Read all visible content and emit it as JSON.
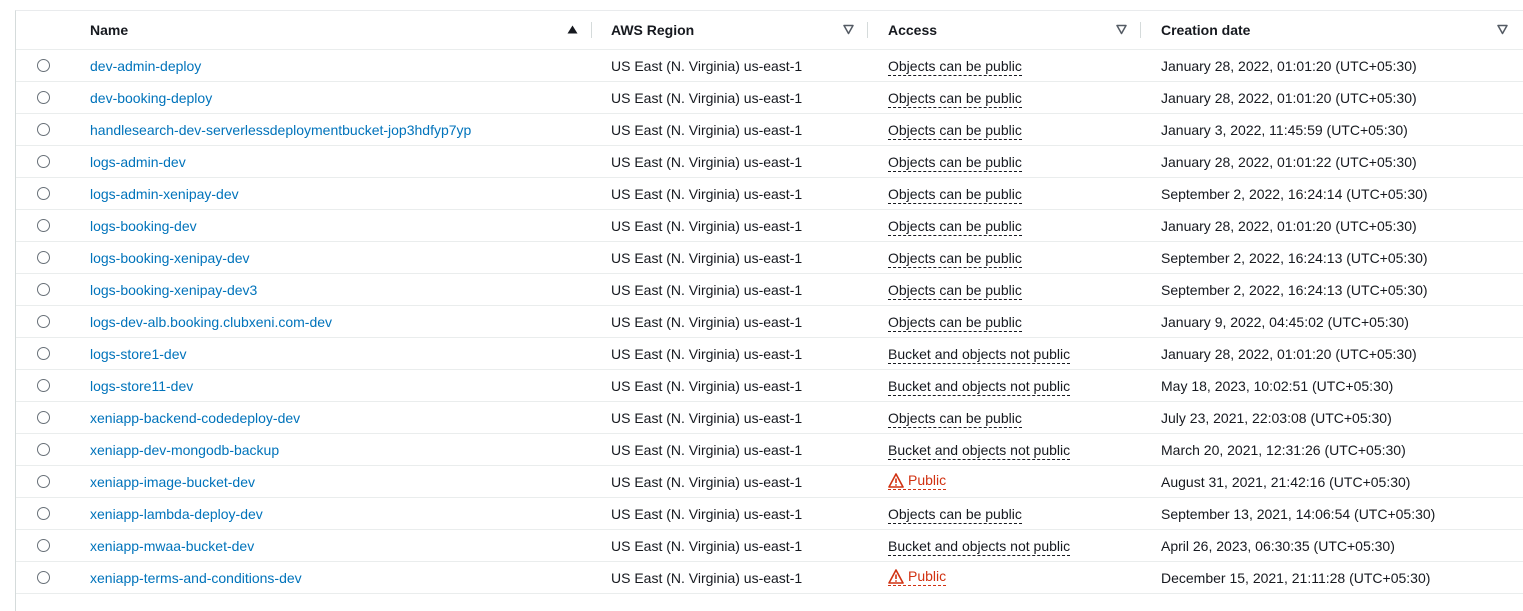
{
  "columns": {
    "name": "Name",
    "region": "AWS Region",
    "access": "Access",
    "date": "Creation date"
  },
  "sort": {
    "column": "Name",
    "direction": "ascending"
  },
  "colors": {
    "link": "#0073bb",
    "warning": "#d13212"
  },
  "icons": {
    "public_warning": "warning-triangle-icon"
  },
  "buckets": [
    {
      "name": "dev-admin-deploy",
      "region": "US East (N. Virginia) us-east-1",
      "access": "Objects can be public",
      "public": false,
      "created": "January 28, 2022, 01:01:20 (UTC+05:30)"
    },
    {
      "name": "dev-booking-deploy",
      "region": "US East (N. Virginia) us-east-1",
      "access": "Objects can be public",
      "public": false,
      "created": "January 28, 2022, 01:01:20 (UTC+05:30)"
    },
    {
      "name": "handlesearch-dev-serverlessdeploymentbucket-jop3hdfyp7yp",
      "region": "US East (N. Virginia) us-east-1",
      "access": "Objects can be public",
      "public": false,
      "created": "January 3, 2022, 11:45:59 (UTC+05:30)"
    },
    {
      "name": "logs-admin-dev",
      "region": "US East (N. Virginia) us-east-1",
      "access": "Objects can be public",
      "public": false,
      "created": "January 28, 2022, 01:01:22 (UTC+05:30)"
    },
    {
      "name": "logs-admin-xenipay-dev",
      "region": "US East (N. Virginia) us-east-1",
      "access": "Objects can be public",
      "public": false,
      "created": "September 2, 2022, 16:24:14 (UTC+05:30)"
    },
    {
      "name": "logs-booking-dev",
      "region": "US East (N. Virginia) us-east-1",
      "access": "Objects can be public",
      "public": false,
      "created": "January 28, 2022, 01:01:20 (UTC+05:30)"
    },
    {
      "name": "logs-booking-xenipay-dev",
      "region": "US East (N. Virginia) us-east-1",
      "access": "Objects can be public",
      "public": false,
      "created": "September 2, 2022, 16:24:13 (UTC+05:30)"
    },
    {
      "name": "logs-booking-xenipay-dev3",
      "region": "US East (N. Virginia) us-east-1",
      "access": "Objects can be public",
      "public": false,
      "created": "September 2, 2022, 16:24:13 (UTC+05:30)"
    },
    {
      "name": "logs-dev-alb.booking.clubxeni.com-dev",
      "region": "US East (N. Virginia) us-east-1",
      "access": "Objects can be public",
      "public": false,
      "created": "January 9, 2022, 04:45:02 (UTC+05:30)"
    },
    {
      "name": "logs-store1-dev",
      "region": "US East (N. Virginia) us-east-1",
      "access": "Bucket and objects not public",
      "public": false,
      "created": "January 28, 2022, 01:01:20 (UTC+05:30)"
    },
    {
      "name": "logs-store11-dev",
      "region": "US East (N. Virginia) us-east-1",
      "access": "Bucket and objects not public",
      "public": false,
      "created": "May 18, 2023, 10:02:51 (UTC+05:30)"
    },
    {
      "name": "xeniapp-backend-codedeploy-dev",
      "region": "US East (N. Virginia) us-east-1",
      "access": "Objects can be public",
      "public": false,
      "created": "July 23, 2021, 22:03:08 (UTC+05:30)"
    },
    {
      "name": "xeniapp-dev-mongodb-backup",
      "region": "US East (N. Virginia) us-east-1",
      "access": "Bucket and objects not public",
      "public": false,
      "created": "March 20, 2021, 12:31:26 (UTC+05:30)"
    },
    {
      "name": "xeniapp-image-bucket-dev",
      "region": "US East (N. Virginia) us-east-1",
      "access": "Public",
      "public": true,
      "created": "August 31, 2021, 21:42:16 (UTC+05:30)"
    },
    {
      "name": "xeniapp-lambda-deploy-dev",
      "region": "US East (N. Virginia) us-east-1",
      "access": "Objects can be public",
      "public": false,
      "created": "September 13, 2021, 14:06:54 (UTC+05:30)"
    },
    {
      "name": "xeniapp-mwaa-bucket-dev",
      "region": "US East (N. Virginia) us-east-1",
      "access": "Bucket and objects not public",
      "public": false,
      "created": "April 26, 2023, 06:30:35 (UTC+05:30)"
    },
    {
      "name": "xeniapp-terms-and-conditions-dev",
      "region": "US East (N. Virginia) us-east-1",
      "access": "Public",
      "public": true,
      "created": "December 15, 2021, 21:11:28 (UTC+05:30)"
    }
  ]
}
